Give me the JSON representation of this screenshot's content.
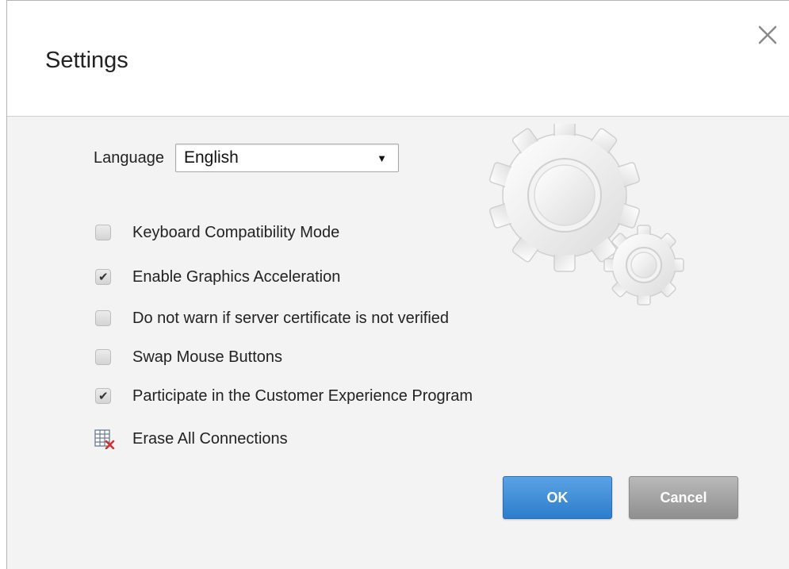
{
  "dialog": {
    "title": "Settings",
    "close_icon": "close-icon"
  },
  "language": {
    "label": "Language",
    "selected": "English",
    "arrow": "▼"
  },
  "options": [
    {
      "label": "Keyboard Compatibility Mode",
      "checked": false
    },
    {
      "label": "Enable Graphics Acceleration",
      "checked": true
    },
    {
      "label": "Do not warn if server certificate is not verified",
      "checked": false
    },
    {
      "label": "Swap Mouse Buttons",
      "checked": false
    },
    {
      "label": "Participate in the Customer Experience Program",
      "checked": true
    }
  ],
  "check_glyph": "✔",
  "erase": {
    "label": "Erase All Connections",
    "icon": "erase-table-icon"
  },
  "decoration": {
    "icon": "gears-icon"
  },
  "buttons": {
    "ok": "OK",
    "cancel": "Cancel"
  },
  "colors": {
    "ok_button": "#2d7dcc",
    "cancel_button": "#9a9a9a",
    "erase_icon_x": "#d22f2f"
  }
}
